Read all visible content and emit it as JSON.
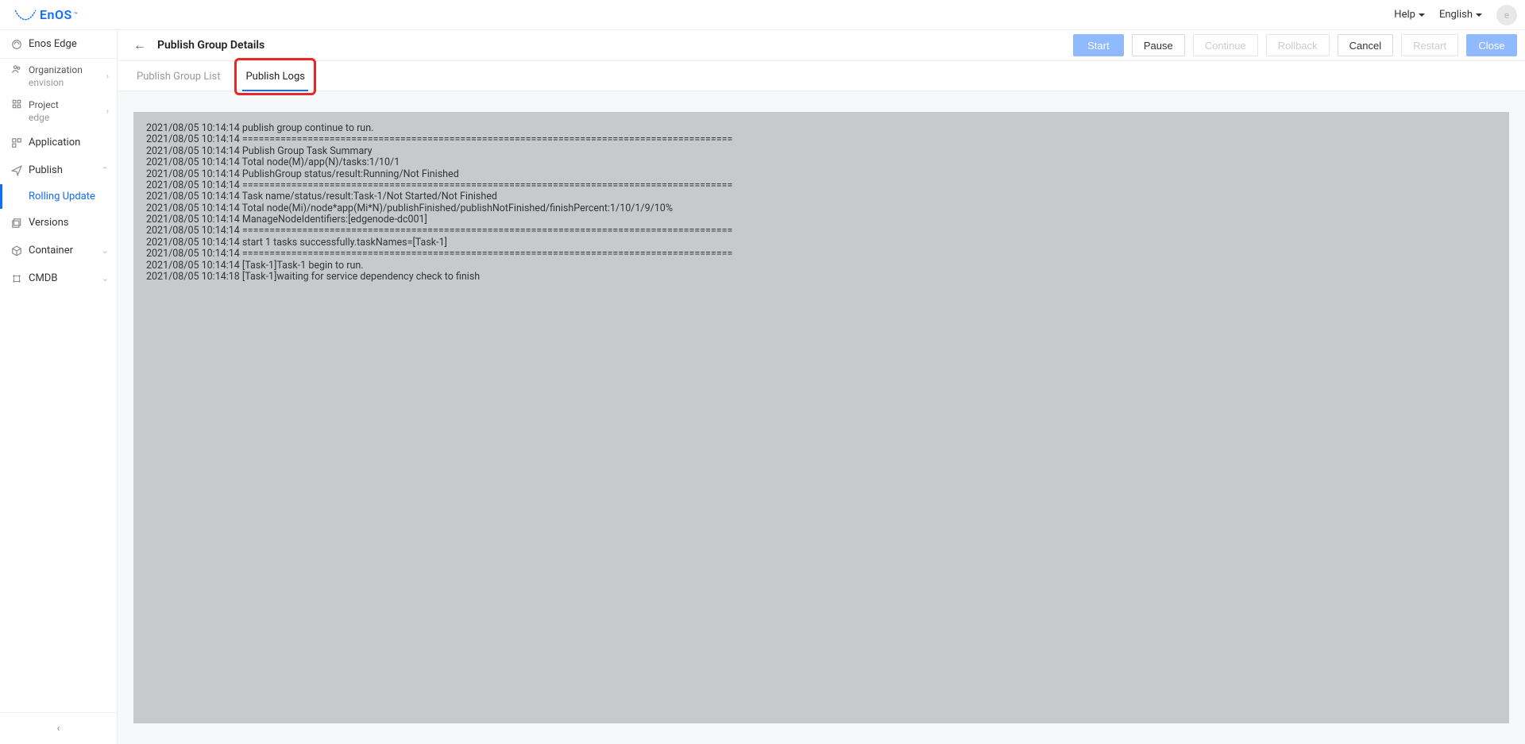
{
  "brand": {
    "name": "EnOS",
    "sup": "™"
  },
  "topbar": {
    "help": "Help",
    "language": "English",
    "avatar_initial": "e"
  },
  "sidebar": {
    "product": "Enos Edge",
    "org_label": "Organization",
    "org_value": "envision",
    "project_label": "Project",
    "project_value": "edge",
    "items": {
      "application": "Application",
      "publish": "Publish",
      "rolling_update": "Rolling Update",
      "versions": "Versions",
      "container": "Container",
      "cmdb": "CMDB"
    }
  },
  "header": {
    "title": "Publish Group Details",
    "actions": {
      "start": "Start",
      "pause": "Pause",
      "continue": "Continue",
      "rollback": "Rollback",
      "cancel": "Cancel",
      "restart": "Restart",
      "close": "Close"
    }
  },
  "tabs": {
    "list": "Publish Group List",
    "logs": "Publish Logs"
  },
  "log_text": "2021/08/05 10:14:14 publish group continue to run.\n2021/08/05 10:14:14 ==========================================================================================\n2021/08/05 10:14:14 Publish Group Task Summary\n2021/08/05 10:14:14 Total node(M)/app(N)/tasks:1/10/1\n2021/08/05 10:14:14 PublishGroup status/result:Running/Not Finished\n2021/08/05 10:14:14 ==========================================================================================\n2021/08/05 10:14:14 Task name/status/result:Task-1/Not Started/Not Finished\n2021/08/05 10:14:14 Total node(Mi)/node*app(Mi*N)/publishFinished/publishNotFinished/finishPercent:1/10/1/9/10%\n2021/08/05 10:14:14 ManageNodeIdentifiers:[edgenode-dc001]\n2021/08/05 10:14:14 ==========================================================================================\n2021/08/05 10:14:14 start 1 tasks successfully.taskNames=[Task-1]\n2021/08/05 10:14:14 ==========================================================================================\n2021/08/05 10:14:14 [Task-1]Task-1 begin to run.\n2021/08/05 10:14:18 [Task-1]waiting for service dependency check to finish"
}
